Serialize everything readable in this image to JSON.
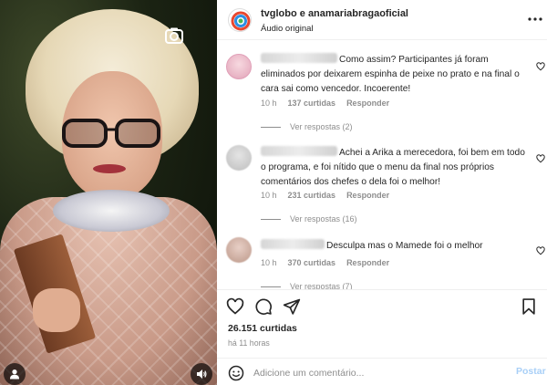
{
  "post": {
    "authors": "tvglobo e anamariabragaoficial",
    "audio": "Áudio original",
    "likes": "26.151 curtidas",
    "posted": "há 11 horas"
  },
  "comments": [
    {
      "text": "Como assim? Participantes já foram eliminados por deixarem espinha de peixe no prato e na final o cara sai como vencedor. Incoerente!",
      "time": "10 h",
      "likes": "137 curtidas",
      "reply": "Responder",
      "view_replies": "Ver respostas (2)"
    },
    {
      "text": "Achei a Arika a merecedora, foi bem em todo o programa, e foi nítido que o menu da final nos próprios comentários dos chefes o dela foi o melhor!",
      "time": "10 h",
      "likes": "231 curtidas",
      "reply": "Responder",
      "view_replies": "Ver respostas (16)"
    },
    {
      "text": "Desculpa mas o Mamede foi o melhor",
      "time": "10 h",
      "likes": "370 curtidas",
      "reply": "Responder",
      "view_replies": "Ver respostas (7)"
    }
  ],
  "composer": {
    "placeholder": "Adicione um comentário...",
    "post_label": "Postar"
  },
  "icons": {
    "more": "more-options-icon",
    "like": "heart-icon",
    "comment": "comment-icon",
    "share": "share-icon",
    "save": "bookmark-icon",
    "emoji": "emoji-icon",
    "camera": "camera-icon",
    "user_tags": "user-tag-icon",
    "audio": "speaker-icon"
  },
  "colors": {
    "text": "#262626",
    "muted": "#8e8e8e",
    "post_button": "#a8cff7",
    "divider": "#efefef"
  }
}
